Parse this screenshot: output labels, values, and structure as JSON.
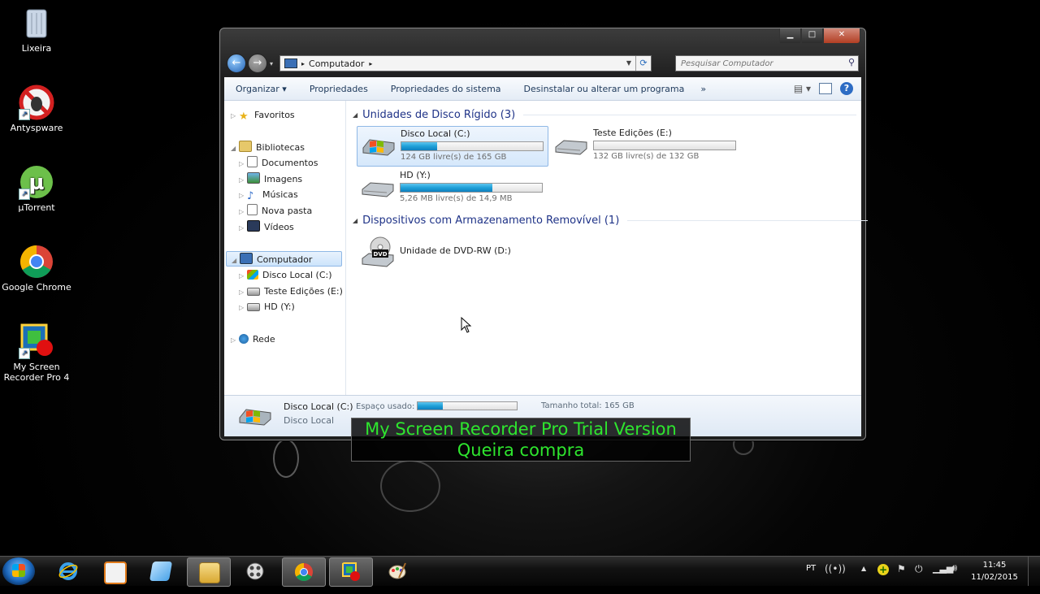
{
  "desktop": {
    "icons": [
      {
        "label": "Lixeira",
        "icon": "recycle-bin-icon"
      },
      {
        "label": "Antyspware",
        "icon": "antispyware-icon"
      },
      {
        "label": "µTorrent",
        "icon": "utorrent-icon"
      },
      {
        "label": "Google Chrome",
        "icon": "chrome-icon"
      },
      {
        "label": "My Screen Recorder Pro 4",
        "icon": "screen-recorder-icon"
      }
    ]
  },
  "window": {
    "breadcrumb": "Computador",
    "search_placeholder": "Pesquisar Computador",
    "toolbar": {
      "organize": "Organizar",
      "properties": "Propriedades",
      "system_properties": "Propriedades do sistema",
      "uninstall": "Desinstalar ou alterar um programa",
      "more": "»"
    },
    "nav": {
      "favorites": "Favoritos",
      "libraries": "Bibliotecas",
      "documents": "Documentos",
      "images": "Imagens",
      "music": "Músicas",
      "new_folder": "Nova pasta",
      "videos": "Vídeos",
      "computer": "Computador",
      "disk_c": "Disco Local (C:)",
      "disk_e": "Teste Edições (E:)",
      "disk_y": "HD  (Y:)",
      "network": "Rede"
    },
    "groups": {
      "hard_disks": "Unidades de Disco Rígido (3)",
      "removable": "Dispositivos com Armazenamento Removível (1)"
    },
    "drives": [
      {
        "name": "Disco Local (C:)",
        "free": "124 GB livre(s) de 165 GB",
        "used_fraction": 0.25
      },
      {
        "name": "Teste Edições (E:)",
        "free": "132 GB livre(s) de 132 GB",
        "used_fraction": 0.0
      },
      {
        "name": "HD  (Y:)",
        "free": "5,26 MB livre(s) de 14,9 MB",
        "used_fraction": 0.65
      }
    ],
    "dvd": {
      "name": "Unidade de DVD-RW (D:)",
      "badge": "DVD"
    },
    "details": {
      "name": "Disco Local (C:)",
      "type": "Disco Local",
      "used_label": "Espaço usado:",
      "used_fraction": 0.25,
      "total": "Tamanho total: 165 GB"
    }
  },
  "watermark": {
    "line1": "My Screen Recorder Pro Trial Version",
    "line2": "Queira compra"
  },
  "taskbar": {
    "language": "PT",
    "time": "11:45",
    "date": "11/02/2015"
  }
}
